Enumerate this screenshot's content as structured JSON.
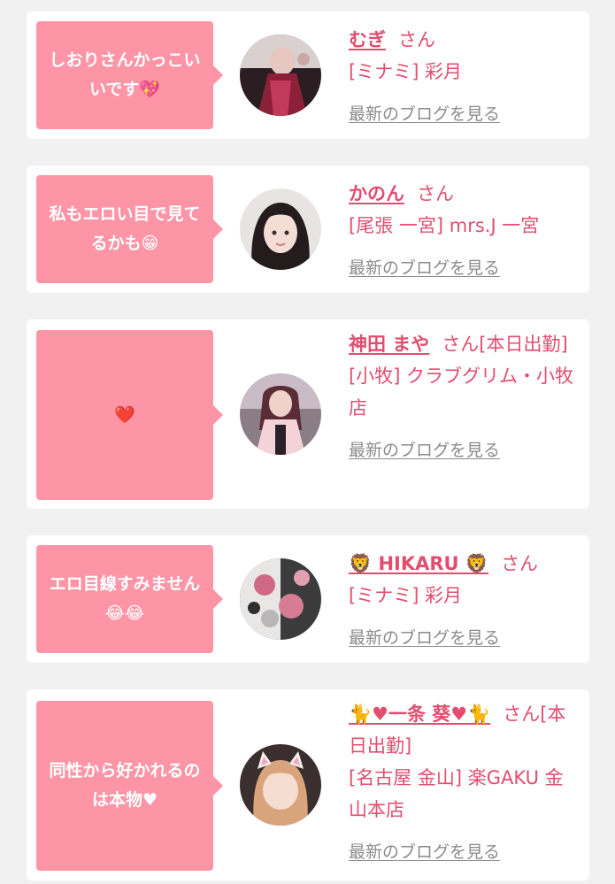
{
  "cards": [
    {
      "comment": "しおりさんかっこいいです💖",
      "name": "むぎ",
      "honorific": "さん",
      "shop": "[ミナミ] 彩月",
      "blog_link": "最新のブログを見る"
    },
    {
      "comment": "私もエロい目で見てるかも😁",
      "name": "かのん",
      "honorific": "さん",
      "shop": "[尾張 一宮] mrs.J 一宮",
      "blog_link": "最新のブログを見る"
    },
    {
      "comment": "❤️",
      "name": "神田 まや",
      "honorific": "さん[本日出勤]",
      "shop": "[小牧] クラブグリム・小牧店",
      "blog_link": "最新のブログを見る"
    },
    {
      "comment": "エロ目線すみません😂😂",
      "name": "🦁 HIKARU 🦁",
      "honorific": "さん",
      "shop": "[ミナミ] 彩月",
      "blog_link": "最新のブログを見る"
    },
    {
      "comment": "同性から好かれるのは本物♥",
      "name": "🐈♥一条 葵♥🐈",
      "honorific": "さん[本日出勤]",
      "shop": "[名古屋 金山] 楽GAKU 金山本店",
      "blog_link": "最新のブログを見る"
    }
  ],
  "colors": {
    "bubble": "#fd95a6",
    "accent": "#e24d6f",
    "link_gray": "#8b8b8b",
    "page_bg": "#f1f1f1"
  }
}
